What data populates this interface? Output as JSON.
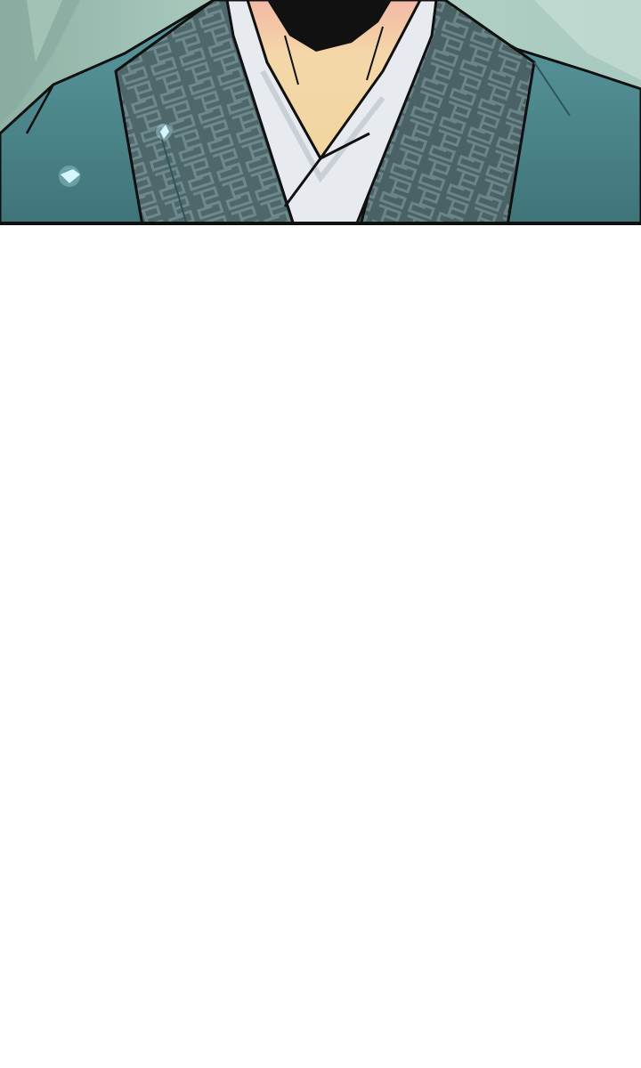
{
  "comic": {
    "panels": [
      {
        "subject": "character-torso-in-robe",
        "colors": {
          "background_mist": "#9fc2b5",
          "robe_teal": "#4f8f94",
          "robe_dark": "#3e6f74",
          "collar_pattern": "#4c6569",
          "inner_collar": "#e9ecef",
          "skin": "#f3d5a6",
          "outline": "#101010",
          "sparkle": "#dff9ff"
        }
      }
    ],
    "gutter": {
      "color": "#ffffff"
    }
  }
}
